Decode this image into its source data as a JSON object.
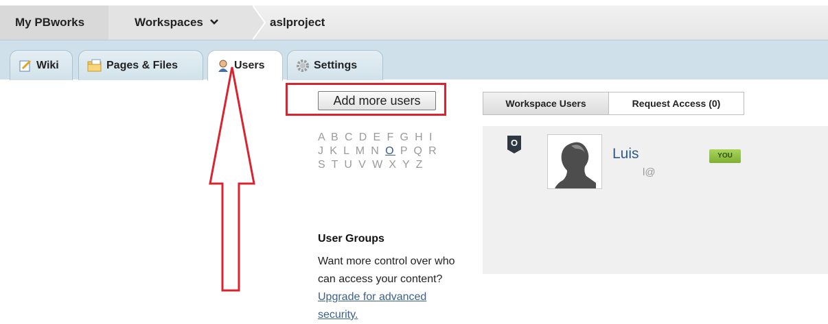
{
  "breadcrumb": {
    "home": "My PBworks",
    "workspaces": "Workspaces",
    "project": "aslproject"
  },
  "tabs": [
    {
      "label": "Wiki",
      "icon": "edit-page-icon"
    },
    {
      "label": "Pages & Files",
      "icon": "folder-icon"
    },
    {
      "label": "Users",
      "icon": "user-icon",
      "active": true
    },
    {
      "label": "Settings",
      "icon": "gear-icon"
    }
  ],
  "users_page": {
    "add_button": "Add more users",
    "alphabet_rows": [
      "A B C D E F G H I",
      "J K L M N",
      "O",
      "P Q R",
      "S T U V W X Y Z"
    ],
    "groups_title": "User Groups",
    "groups_text": "Want more control over who can access your content?",
    "groups_link": "Upgrade for advanced security."
  },
  "panel": {
    "tab_users": "Workspace Users",
    "tab_requests": "Request Access (0)",
    "role_badge": "O",
    "user_name": "Luis",
    "user_email_fragment": "l@",
    "you_badge": "YOU"
  },
  "colors": {
    "annotation_red": "#d9232e",
    "tab_band": "#cfe0ea",
    "link_blue": "#3b5f8d"
  }
}
